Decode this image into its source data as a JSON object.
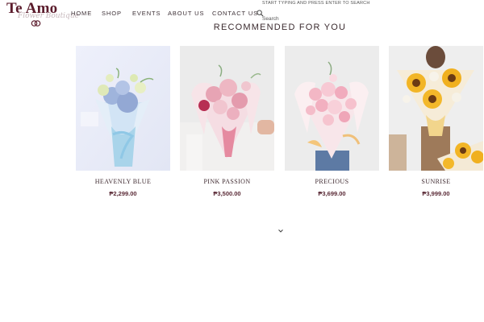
{
  "brand": {
    "logo_text": "Te Amo",
    "logo_subtext": "Flower Boutique"
  },
  "nav": {
    "items": [
      {
        "label": "HOME"
      },
      {
        "label": "SHOP"
      },
      {
        "label": "EVENTS"
      },
      {
        "label": "ABOUT US"
      },
      {
        "label": "CONTACT US"
      }
    ]
  },
  "search": {
    "icon": "search-icon",
    "hint": "START TYPING AND PRESS ENTER TO SEARCH",
    "placeholder": "Search",
    "value": ""
  },
  "section": {
    "title": "RECOMMENDED FOR YOU"
  },
  "products": [
    {
      "name": "HEAVENLY BLUE",
      "price": "₱2,299.00"
    },
    {
      "name": "PINK PASSION",
      "price": "₱3,500.00"
    },
    {
      "name": "PRECIOUS",
      "price": "₱3,699.00"
    },
    {
      "name": "SUNRISE",
      "price": "₱3,999.00"
    }
  ],
  "scroll_icon": "chevron-down-icon",
  "colors": {
    "brand": "#5b1c2c",
    "text": "#3a2a2e",
    "price": "#5a2a36"
  }
}
